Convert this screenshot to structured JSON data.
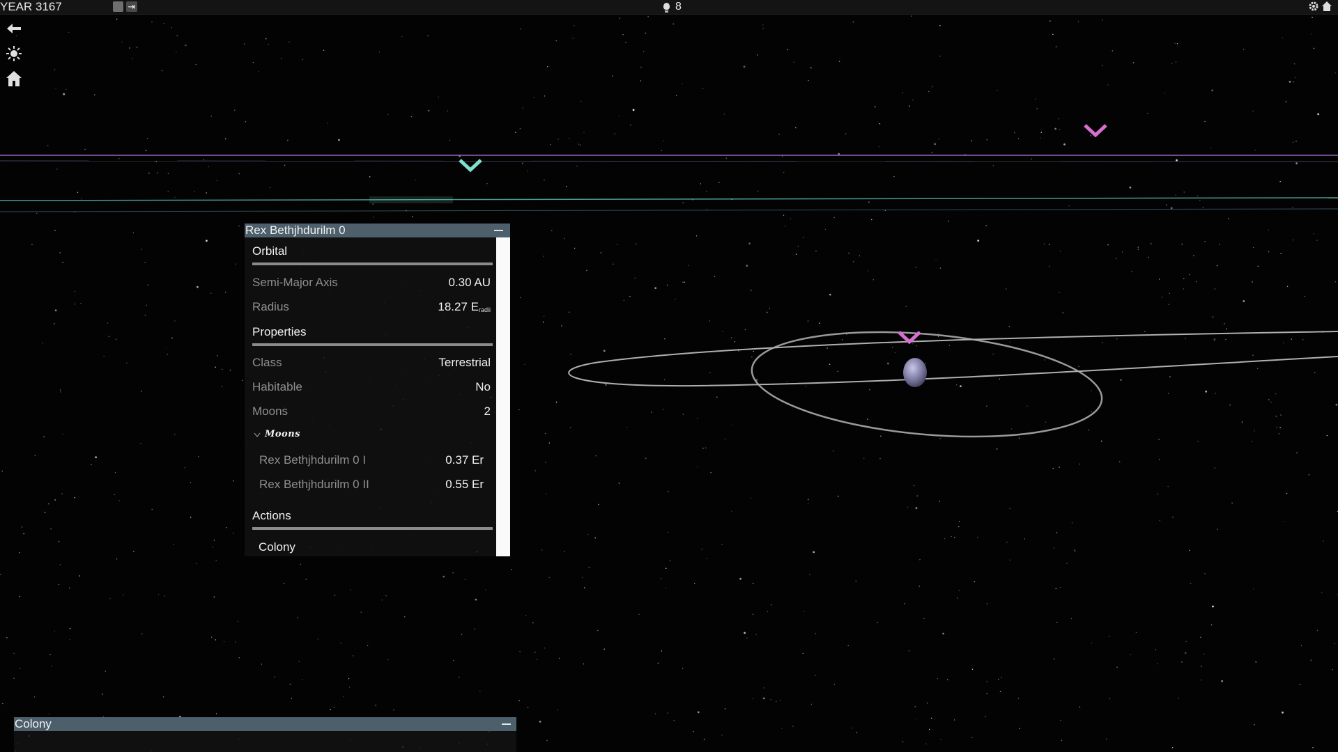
{
  "topbar": {
    "year": "YEAR 3167",
    "research_count": "8",
    "icons": [
      "stop-square-icon",
      "exit-arrow-icon",
      "bulb-icon",
      "gear-icon",
      "home-icon"
    ]
  },
  "toolbar": {
    "icons": [
      "back-arrow-icon",
      "star-system-icon",
      "home-icon"
    ]
  },
  "planet_panel": {
    "title": "Rex Bethjhdurilm 0",
    "orbital": {
      "heading": "Orbital",
      "semi_major_axis_label": "Semi-Major Axis",
      "semi_major_axis_value": "0.30 AU",
      "radius_label": "Radius",
      "radius_value": "18.27 E",
      "radius_unit_sub": "radii"
    },
    "properties": {
      "heading": "Properties",
      "class_label": "Class",
      "class_value": "Terrestrial",
      "habitable_label": "Habitable",
      "habitable_value": "No",
      "moons_label": "Moons",
      "moons_value": "2"
    },
    "moons": {
      "toggle_label": "Moons",
      "items": [
        {
          "name": "Rex Bethjhdurilm 0 I",
          "value": "0.37 Er"
        },
        {
          "name": "Rex Bethjhdurilm 0 II",
          "value": "0.55 Er"
        }
      ]
    },
    "actions": {
      "heading": "Actions",
      "colony_button": "Colony"
    }
  },
  "colony_panel": {
    "title": "Colony"
  },
  "colors": {
    "panel_title": "#4c5f6b",
    "marker_pink": "#d86fd0",
    "marker_cyan": "#7fe0cc",
    "orbit": "#a8a8a8"
  }
}
